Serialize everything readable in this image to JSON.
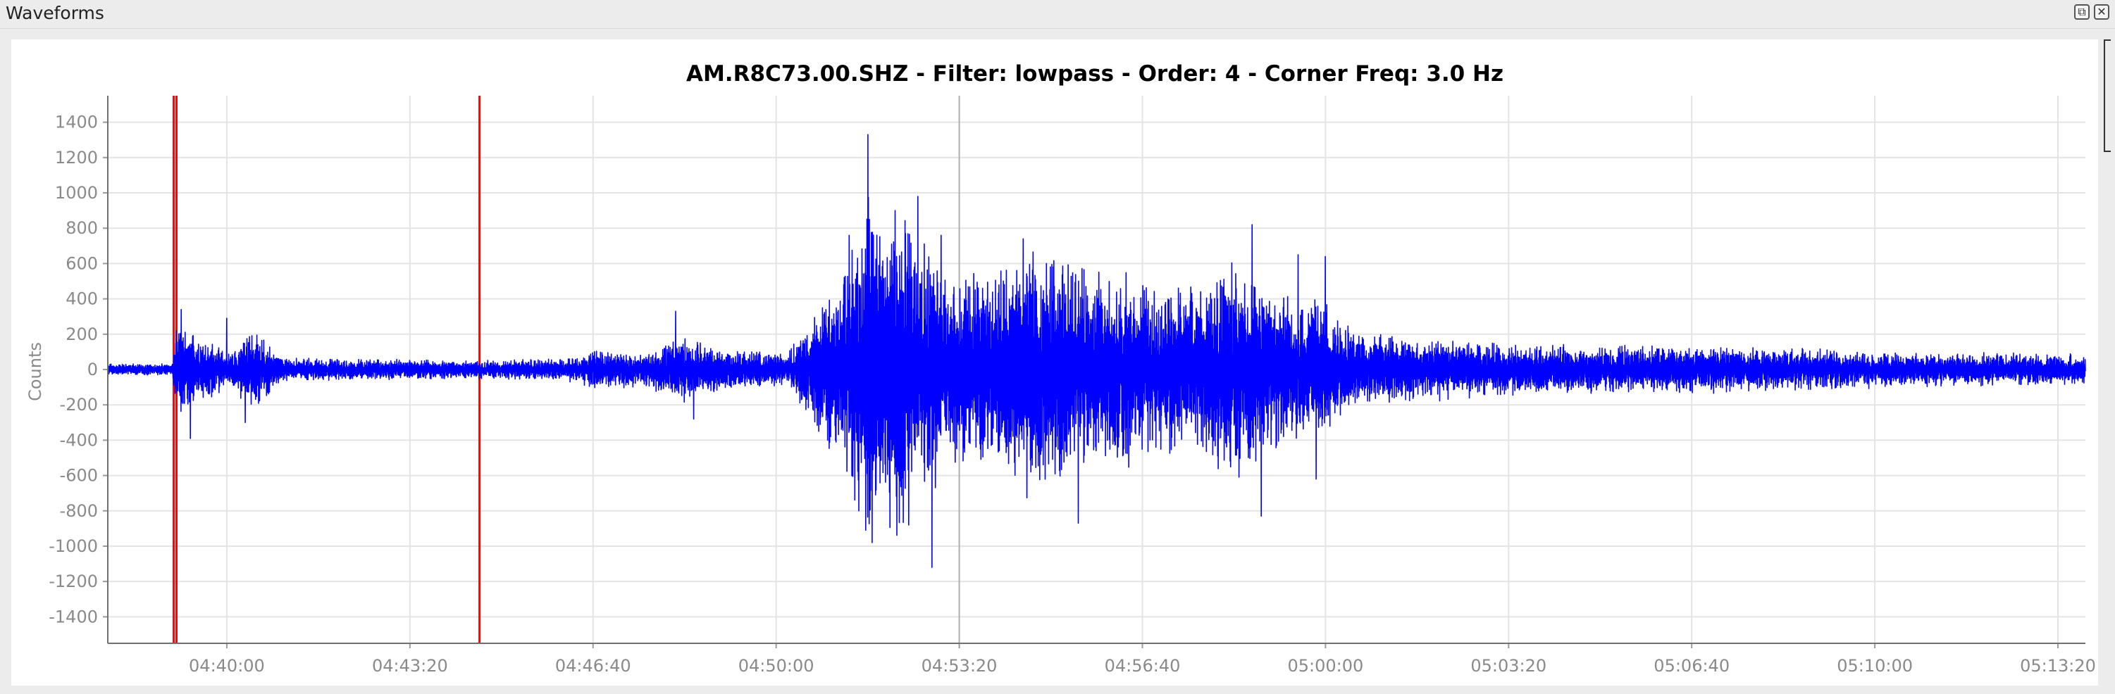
{
  "window": {
    "title": "Waveforms",
    "float_glyph": "⧉",
    "close_glyph": "✕"
  },
  "chart_data": {
    "type": "line",
    "title": "AM.R8C73.00.SHZ - Filter: lowpass - Order: 4 - Corner Freq: 3.0 Hz",
    "xlabel": "",
    "ylabel": "Counts",
    "x_range": [
      "04:37:50",
      "05:13:50"
    ],
    "x_ticks": [
      "04:40:00",
      "04:43:20",
      "04:46:40",
      "04:50:00",
      "04:53:20",
      "04:56:40",
      "05:00:00",
      "05:03:20",
      "05:06:40",
      "05:10:00",
      "05:13:20"
    ],
    "ylim": [
      -1550,
      1550
    ],
    "y_ticks": [
      1400,
      1200,
      1000,
      800,
      600,
      400,
      200,
      0,
      -200,
      -400,
      -600,
      -800,
      -1000,
      -1200,
      -1400
    ],
    "grid": true,
    "colors": {
      "trace": "#0000ff",
      "pick": "#ff0000",
      "cursor": "#b0b0b0",
      "grid": "#e4e4e4",
      "tick_text": "#8a8a8a",
      "title": "#000000"
    },
    "markers": [
      {
        "kind": "pick",
        "time": "04:39:02"
      },
      {
        "kind": "pick",
        "time": "04:39:05"
      },
      {
        "kind": "pick",
        "time": "04:44:36"
      },
      {
        "kind": "cursor",
        "time": "04:53:20"
      }
    ],
    "envelope_times": [
      "04:37:50",
      "04:39:00",
      "04:39:05",
      "04:39:40",
      "04:40:00",
      "04:40:30",
      "04:41:00",
      "04:44:00",
      "04:46:10",
      "04:46:40",
      "04:47:30",
      "04:48:20",
      "04:48:40",
      "04:49:20",
      "04:50:10",
      "04:51:10",
      "04:51:40",
      "04:52:20",
      "04:53:00",
      "04:53:40",
      "04:54:40",
      "04:55:40",
      "04:56:40",
      "04:57:40",
      "04:58:20",
      "04:59:10",
      "05:00:00",
      "05:00:40",
      "05:02:00",
      "05:03:20",
      "05:05:00",
      "05:07:00",
      "05:09:00",
      "05:11:00",
      "05:13:50"
    ],
    "envelope_counts": [
      35,
      35,
      250,
      200,
      90,
      250,
      70,
      55,
      65,
      120,
      100,
      200,
      150,
      120,
      100,
      550,
      1100,
      1000,
      650,
      580,
      750,
      600,
      550,
      480,
      700,
      450,
      420,
      220,
      180,
      160,
      140,
      140,
      120,
      100,
      90
    ],
    "peaks": [
      {
        "time": "04:39:10",
        "counts": 340
      },
      {
        "time": "04:39:20",
        "counts": -390
      },
      {
        "time": "04:40:00",
        "counts": 290
      },
      {
        "time": "04:40:20",
        "counts": -300
      },
      {
        "time": "04:48:10",
        "counts": 330
      },
      {
        "time": "04:48:30",
        "counts": -280
      },
      {
        "time": "04:51:20",
        "counts": 760
      },
      {
        "time": "04:51:30",
        "counts": -800
      },
      {
        "time": "04:51:40",
        "counts": 1330
      },
      {
        "time": "04:51:45",
        "counts": -980
      },
      {
        "time": "04:52:10",
        "counts": 900
      },
      {
        "time": "04:52:25",
        "counts": -880
      },
      {
        "time": "04:52:35",
        "counts": 980
      },
      {
        "time": "04:52:50",
        "counts": -1120
      },
      {
        "time": "04:53:00",
        "counts": 760
      },
      {
        "time": "04:54:30",
        "counts": 740
      },
      {
        "time": "04:55:30",
        "counts": -870
      },
      {
        "time": "04:58:40",
        "counts": 820
      },
      {
        "time": "04:58:50",
        "counts": -830
      },
      {
        "time": "04:59:30",
        "counts": 650
      },
      {
        "time": "04:59:50",
        "counts": -620
      },
      {
        "time": "05:00:00",
        "counts": 640
      }
    ]
  }
}
